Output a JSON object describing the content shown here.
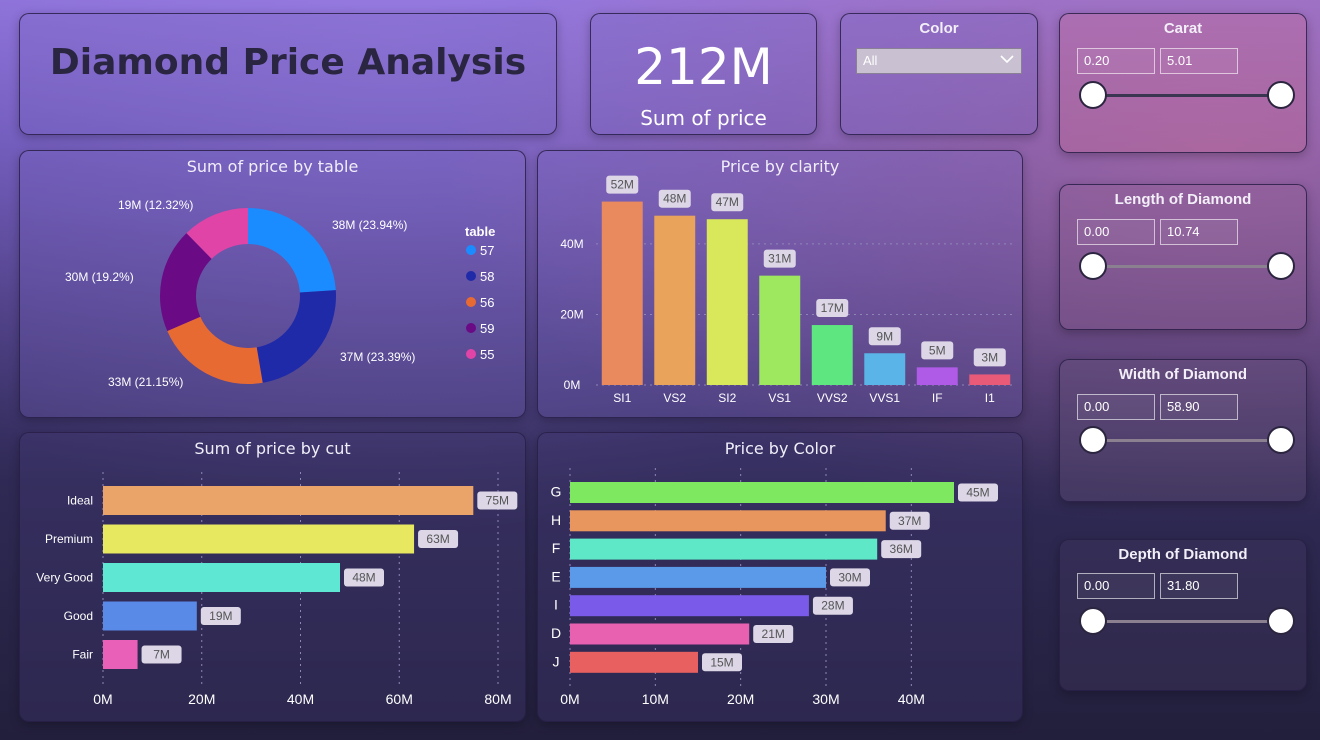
{
  "dashboard": {
    "title": "Diamond Price Analysis"
  },
  "kpi": {
    "value": "212M",
    "label": "Sum of price"
  },
  "color_slicer": {
    "title": "Color",
    "selected": "All"
  },
  "carat_slicer": {
    "title": "Carat",
    "min": "0.20",
    "max": "5.01"
  },
  "length_slicer": {
    "title": "Length of Diamond",
    "min": "0.00",
    "max": "10.74"
  },
  "width_slicer": {
    "title": "Width of Diamond",
    "min": "0.00",
    "max": "58.90"
  },
  "depth_slicer": {
    "title": "Depth of Diamond",
    "min": "0.00",
    "max": "31.80"
  },
  "chart_data": [
    {
      "id": "table",
      "type": "pie",
      "title": "Sum of price by table",
      "legend_title": "table",
      "legend_placement": "right",
      "categories": [
        "57",
        "58",
        "56",
        "59",
        "55"
      ],
      "values": [
        23.94,
        23.39,
        21.15,
        19.2,
        12.32
      ],
      "labels": [
        "38M (23.94%)",
        "37M (23.39%)",
        "33M (21.15%)",
        "30M (19.2%)",
        "19M (12.32%)"
      ],
      "colors": [
        "#1a8cff",
        "#1f2aa8",
        "#e86a33",
        "#6a0a85",
        "#e044a7"
      ]
    },
    {
      "id": "clarity",
      "type": "bar",
      "title": "Price by clarity",
      "categories": [
        "SI1",
        "VS2",
        "SI2",
        "VS1",
        "VVS2",
        "VVS1",
        "IF",
        "I1"
      ],
      "values": [
        52,
        48,
        47,
        31,
        17,
        9,
        5,
        3
      ],
      "value_labels": [
        "52M",
        "48M",
        "47M",
        "31M",
        "17M",
        "9M",
        "5M",
        "3M"
      ],
      "y_ticks": [
        "0M",
        "20M",
        "40M"
      ],
      "y_tick_values": [
        0,
        20,
        40
      ],
      "ylim": [
        0,
        55
      ],
      "colors": [
        "#e88a5e",
        "#eaa35a",
        "#d9e85a",
        "#9ee860",
        "#5ee680",
        "#5ab4e8",
        "#b05ae8",
        "#e85a78"
      ]
    },
    {
      "id": "cut",
      "type": "bar",
      "orientation": "horizontal",
      "title": "Sum of price by cut",
      "categories": [
        "Ideal",
        "Premium",
        "Very Good",
        "Good",
        "Fair"
      ],
      "values": [
        75,
        63,
        48,
        19,
        7
      ],
      "value_labels": [
        "75M",
        "63M",
        "48M",
        "19M",
        "7M"
      ],
      "x_ticks": [
        "0M",
        "20M",
        "40M",
        "60M",
        "80M"
      ],
      "x_tick_values": [
        0,
        20,
        40,
        60,
        80
      ],
      "xlim": [
        0,
        80
      ],
      "colors": [
        "#eaa368",
        "#e8e860",
        "#5ee8d4",
        "#5a8ae8",
        "#e860b8"
      ]
    },
    {
      "id": "color",
      "type": "bar",
      "orientation": "horizontal",
      "title": "Price by Color",
      "categories": [
        "G",
        "H",
        "F",
        "E",
        "I",
        "D",
        "J"
      ],
      "values": [
        45,
        37,
        36,
        30,
        28,
        21,
        15
      ],
      "value_labels": [
        "45M",
        "37M",
        "36M",
        "30M",
        "28M",
        "21M",
        "15M"
      ],
      "x_ticks": [
        "0M",
        "10M",
        "20M",
        "30M",
        "40M"
      ],
      "x_tick_values": [
        0,
        10,
        20,
        30,
        40
      ],
      "xlim": [
        0,
        45
      ],
      "colors": [
        "#7ee860",
        "#e8955e",
        "#5ee8c8",
        "#5a9ae8",
        "#7a5ae8",
        "#e860b0",
        "#e86060"
      ]
    }
  ]
}
